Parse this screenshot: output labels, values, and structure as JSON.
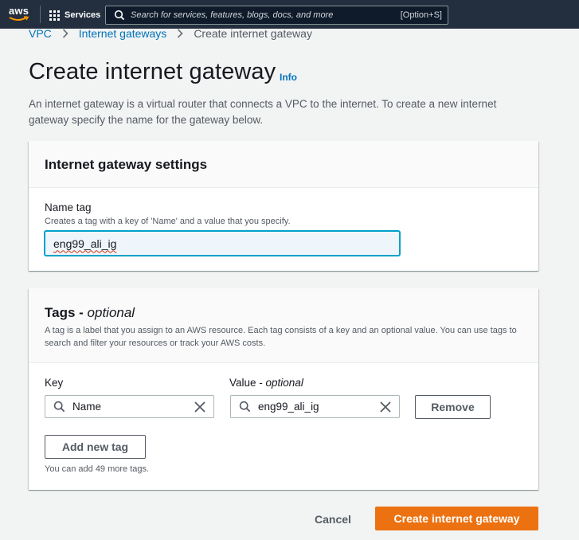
{
  "topbar": {
    "logo_text": "aws",
    "services_label": "Services",
    "search_placeholder": "Search for services, features, blogs, docs, and more",
    "search_shortcut": "[Option+S]"
  },
  "breadcrumb": {
    "items": [
      "VPC",
      "Internet gateways"
    ],
    "current": "Create internet gateway"
  },
  "page": {
    "title": "Create internet gateway",
    "info_label": "Info",
    "description": "An internet gateway is a virtual router that connects a VPC to the internet. To create a new internet gateway specify the name for the gateway below."
  },
  "settings_panel": {
    "title": "Internet gateway settings",
    "name_tag_label": "Name tag",
    "name_tag_hint": "Creates a tag with a key of 'Name' and a value that you specify.",
    "name_tag_value": "eng99_ali_ig"
  },
  "tags_panel": {
    "title": "Tags - ",
    "title_optional": "optional",
    "description": "A tag is a label that you assign to an AWS resource. Each tag consists of a key and an optional value. You can use tags to search and filter your resources or track your AWS costs.",
    "key_label": "Key",
    "value_label": "Value - ",
    "value_label_optional": "optional",
    "rows": [
      {
        "key": "Name",
        "value": "eng99_ali_ig",
        "remove_label": "Remove"
      }
    ],
    "add_tag_label": "Add new tag",
    "remaining_hint": "You can add 49 more tags."
  },
  "footer": {
    "cancel_label": "Cancel",
    "create_label": "Create internet gateway"
  },
  "colors": {
    "topbar_bg": "#232f3e",
    "link": "#0073bb",
    "primary_button": "#ec7211",
    "focus_border": "#00a1c9"
  },
  "icons": [
    "grid-icon",
    "search-icon",
    "chevron-right-icon",
    "clear-icon"
  ]
}
